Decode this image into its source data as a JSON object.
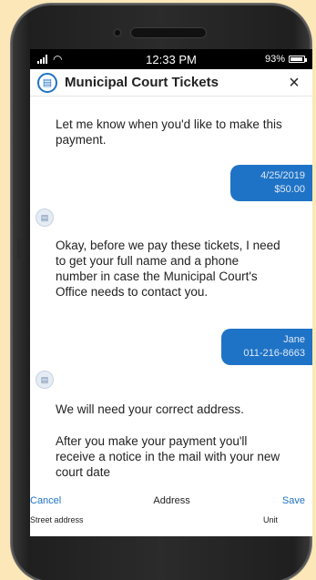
{
  "status_bar": {
    "carrier": ".ıl",
    "wifi_icon": "wifi-icon",
    "time": "12:33 PM",
    "battery_pct": "93%"
  },
  "header": {
    "title": "Municipal Court Tickets",
    "logo_icon": "document-icon",
    "close_icon": "×"
  },
  "messages": [
    {
      "from": "bot",
      "text": "Let me know when you'd like to make this payment."
    },
    {
      "from": "user",
      "lines": [
        "4/25/2019",
        "$50.00"
      ]
    },
    {
      "from": "bot",
      "text": "Okay, before we pay these tickets, I need to get your full name and a phone number in case the Municipal Court's Office needs to contact you."
    },
    {
      "from": "user",
      "lines": [
        "Jane",
        "011-216-8663"
      ]
    },
    {
      "from": "bot",
      "text": "We will need your correct address."
    },
    {
      "from": "bot",
      "text": "After you make your payment you'll receive a notice in the mail with your new court date"
    }
  ],
  "address_form": {
    "cancel_label": "Cancel",
    "title": "Address",
    "save_label": "Save",
    "street_placeholder": "Street address",
    "unit_placeholder": "Unit"
  },
  "colors": {
    "accent": "#1f73c6",
    "background": "#fbe7b8"
  }
}
